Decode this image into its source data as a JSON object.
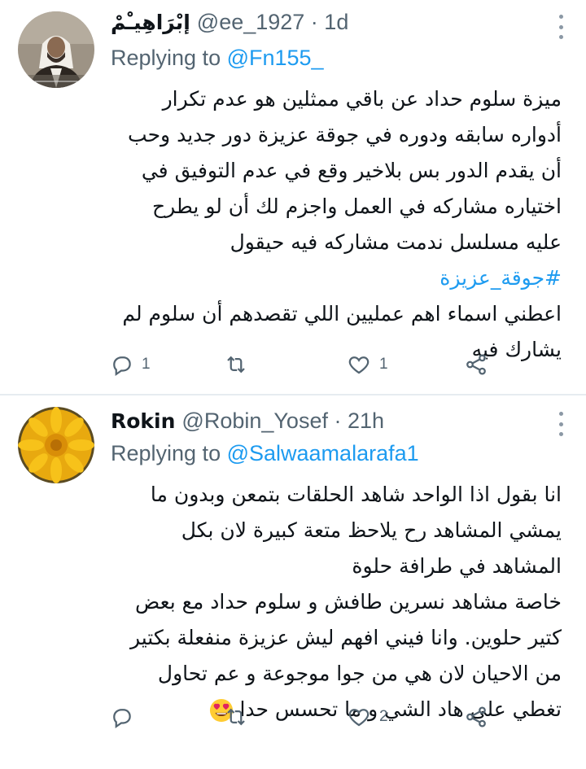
{
  "tweets": [
    {
      "name": "إبْرَاهِيـْمْ",
      "handle": "@ee_1927 · 1d",
      "replying_prefix": "Replying to ",
      "replying_to": "@Fn155_",
      "lines": [
        "ميزة سلوم حداد عن باقي ممثلين هو عدم تكرار",
        "أدواره سابقه ودوره في جوقة عزيزة دور جديد وحب",
        "أن يقدم الدور بس بلاخير وقع في عدم التوفيق في",
        "اختياره مشاركه في العمل واجزم لك أن لو يطرح",
        "عليه مسلسل ندمت مشاركه فيه حيقول"
      ],
      "hashtag": "#جوقة_عزيزة",
      "lines2": [
        "اعطني اسماء اهم عمليين اللي تقصدهم أن سلوم لم",
        "يشارك فيه"
      ],
      "reply_count": "1",
      "retweet_count": "",
      "like_count": "1"
    },
    {
      "name": "Rokin",
      "handle": "@Robin_Yosef · 21h",
      "replying_prefix": "Replying to ",
      "replying_to": "@Salwaamalarafa1",
      "lines": [
        "انا بقول اذا الواحد شاهد الحلقات بتمعن وبدون ما",
        "يمشي المشاهد رح يلاحظ متعة كبيرة لان بكل",
        "المشاهد في طرافة حلوة",
        "خاصة مشاهد نسرين طافش و سلوم حداد مع بعض",
        "كتير حلوين. وانا فيني افهم ليش عزيزة منفعلة بكتير",
        "من الاحيان لان هي من جوا موجوعة و عم تحاول",
        "تغطي على هاد الشي و ما تحسس حدا"
      ],
      "reply_count": "",
      "retweet_count": "",
      "like_count": "2"
    }
  ],
  "colors": {
    "accent": "#1d9bf0",
    "secondary_text": "#536471",
    "divider": "#e6ecf0"
  },
  "icons": [
    "reply-icon",
    "retweet-icon",
    "like-icon",
    "share-icon",
    "more-icon",
    "heart-eyes-emoji"
  ]
}
